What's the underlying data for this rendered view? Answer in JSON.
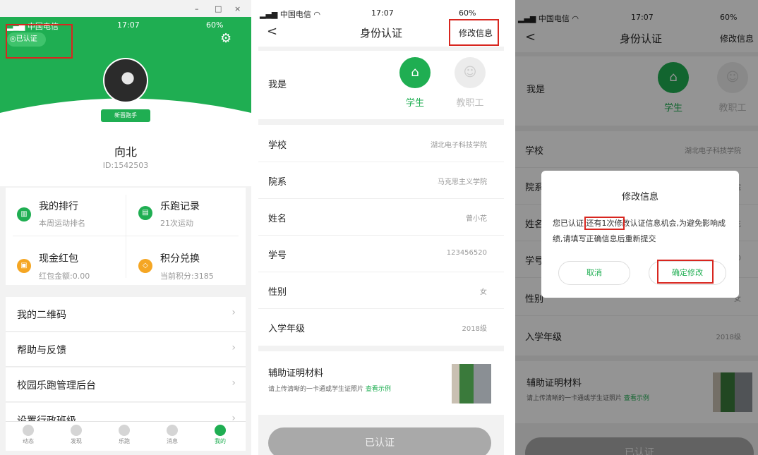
{
  "colors": {
    "green": "#1fae52",
    "red_box": "#d8261f"
  },
  "p1": {
    "status_carrier": "中国电信",
    "status_time": "17:07",
    "status_battery": "60%",
    "window_controls": [
      "–",
      "□",
      "×"
    ],
    "verified_label": "已认证",
    "rank_badge": "新晋跑手",
    "user_name": "向北",
    "user_id": "ID:1542503",
    "cards": [
      {
        "title": "我的排行",
        "sub": "本周运动排名",
        "icon": "chart-icon",
        "color": "#1fae52"
      },
      {
        "title": "乐跑记录",
        "sub": "21次运动",
        "icon": "record-icon",
        "color": "#1fae52"
      },
      {
        "title": "现金红包",
        "sub": "红包金额:0.00",
        "icon": "redpacket-icon",
        "color": "#f5a623"
      },
      {
        "title": "积分兑换",
        "sub": "当前积分:3185",
        "icon": "points-icon",
        "color": "#f5a623"
      }
    ],
    "menu": [
      "我的二维码",
      "帮助与反馈",
      "校园乐跑管理后台",
      "设置行政班级"
    ],
    "tabs": [
      "动态",
      "发现",
      "乐跑",
      "消息",
      "我的"
    ]
  },
  "p2": {
    "status_carrier": "中国电信",
    "status_time": "17:07",
    "status_battery": "60%",
    "back": "<",
    "title": "身份认证",
    "edit_label": "修改信息",
    "iam_label": "我是",
    "role_student": "学生",
    "role_staff": "教职工",
    "fields": [
      {
        "k": "学校",
        "v": "湖北电子科技学院"
      },
      {
        "k": "院系",
        "v": "马克思主义学院"
      },
      {
        "k": "姓名",
        "v": "曾小花"
      },
      {
        "k": "学号",
        "v": "123456520"
      },
      {
        "k": "性别",
        "v": "女"
      },
      {
        "k": "入学年级",
        "v": "2018级"
      }
    ],
    "material_title": "辅助证明材料",
    "material_hint": "请上传清晰的一卡通或学生证照片",
    "material_link": "查看示例",
    "submit_label": "已认证"
  },
  "p3": {
    "status_carrier": "中国电信",
    "status_time": "17:07",
    "status_battery": "60%",
    "back": "<",
    "title": "身份认证",
    "edit_label": "修改信息",
    "iam_label": "我是",
    "role_student": "学生",
    "role_staff": "教职工",
    "fields": [
      {
        "k": "学校",
        "v": "湖北电子科技学院"
      },
      {
        "k": "院系",
        "v": "院"
      },
      {
        "k": "姓名",
        "v": "花"
      },
      {
        "k": "学号",
        "v": "20"
      },
      {
        "k": "性别",
        "v": "女"
      },
      {
        "k": "入学年级",
        "v": "2018级"
      }
    ],
    "material_title": "辅助证明材料",
    "material_hint": "请上传清晰的一卡通或学生证照片",
    "material_link": "查看示例",
    "submit_label": "已认证",
    "modal": {
      "title": "修改信息",
      "body_pre": "您已认证,",
      "body_highlight": "还有1次修",
      "body_post": "改认证信息机会,为避免影响成绩,请填写正确信息后重新提交",
      "cancel": "取消",
      "confirm": "确定修改"
    }
  }
}
